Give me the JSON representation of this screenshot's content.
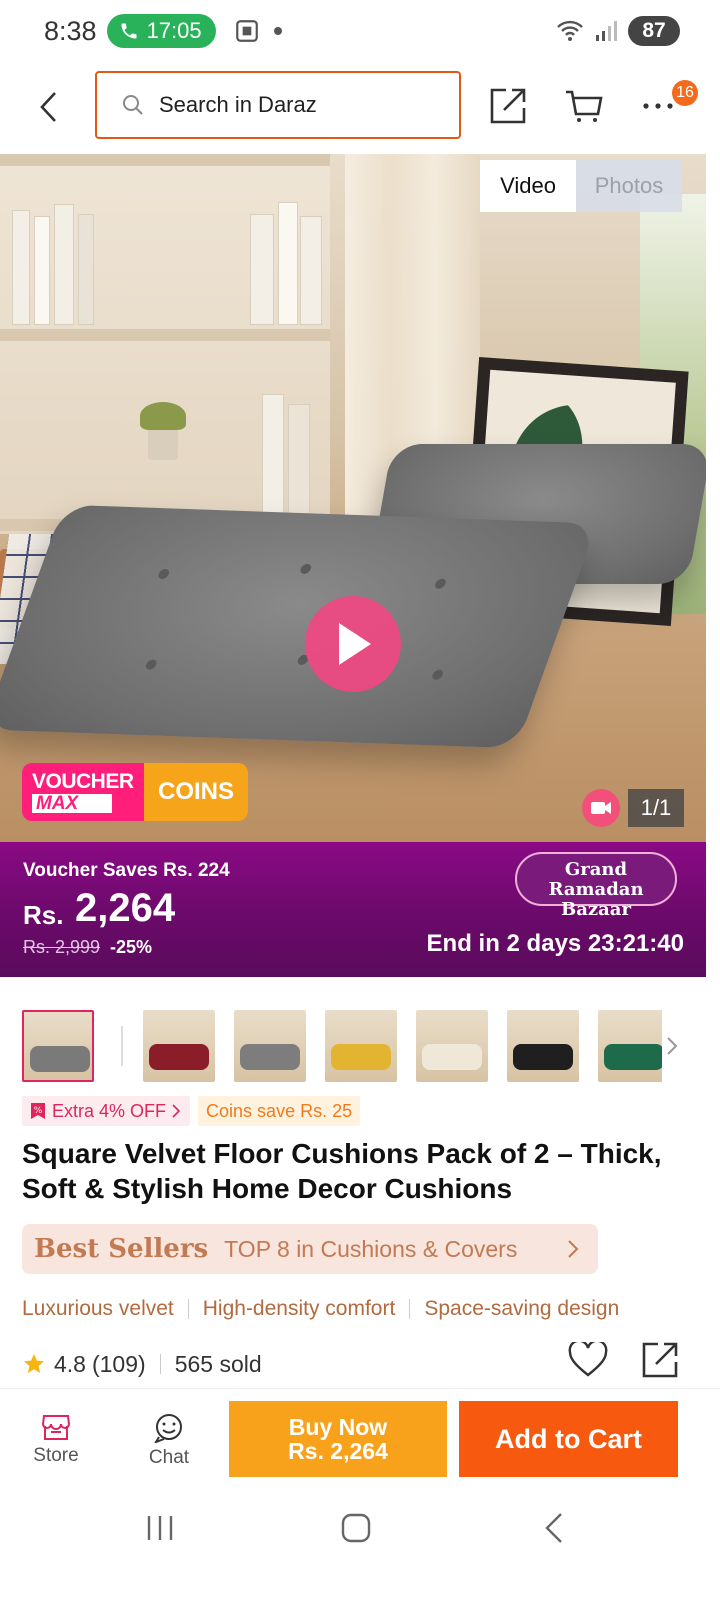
{
  "status_bar": {
    "time": "8:38",
    "call_timer": "17:05",
    "battery": "87"
  },
  "header": {
    "search_placeholder": "Search in Daraz",
    "cart_badge": "16"
  },
  "media": {
    "tabs": [
      {
        "label": "Video",
        "active": true
      },
      {
        "label": "Photos",
        "active": false
      }
    ],
    "voucher_badge": {
      "line1": "VOUCHER",
      "line2": "MAX",
      "coins": "COINS"
    },
    "counter": "1/1"
  },
  "price_banner": {
    "voucher_saves": "Voucher Saves Rs. 224",
    "currency": "Rs.",
    "price": "2,264",
    "original_price": "Rs. 2,999",
    "discount": "-25%",
    "event_line1": "Grand Ramadan",
    "event_line2": "Bazaar",
    "timer": "End in 2 days 23:21:40"
  },
  "thumbnails": [
    {
      "color": "#7a7a7a",
      "selected": true
    },
    {
      "color": "#8b1c2a",
      "selected": false
    },
    {
      "color": "#7d7d7d",
      "selected": false
    },
    {
      "color": "#e2b431",
      "selected": false
    },
    {
      "color": "#efe8d8",
      "selected": false
    },
    {
      "color": "#1f1f1f",
      "selected": false
    },
    {
      "color": "#1d6b4b",
      "selected": false
    }
  ],
  "promos": {
    "extra": "Extra 4% OFF",
    "coins": "Coins save Rs. 25"
  },
  "product": {
    "title": "Square Velvet Floor Cushions Pack of 2 – Thick, Soft & Stylish Home Decor Cushions"
  },
  "best_sellers": {
    "brand": "Best Sellers",
    "text": "TOP 8 in Cushions & Covers"
  },
  "features": [
    "Luxurious velvet",
    "High-density comfort",
    "Space-saving design"
  ],
  "rating": {
    "value": "4.8",
    "count": "(109)",
    "sold": "565 sold"
  },
  "bottom_bar": {
    "store": "Store",
    "chat": "Chat",
    "buy_now_line1": "Buy Now",
    "buy_now_line2": "Rs. 2,264",
    "add_to_cart": "Add to Cart"
  },
  "colors": {
    "accent": "#f7590f",
    "buy_now": "#f8a21c",
    "banner": "#6b0a6a",
    "voucher_pink": "#ff1f7a"
  }
}
